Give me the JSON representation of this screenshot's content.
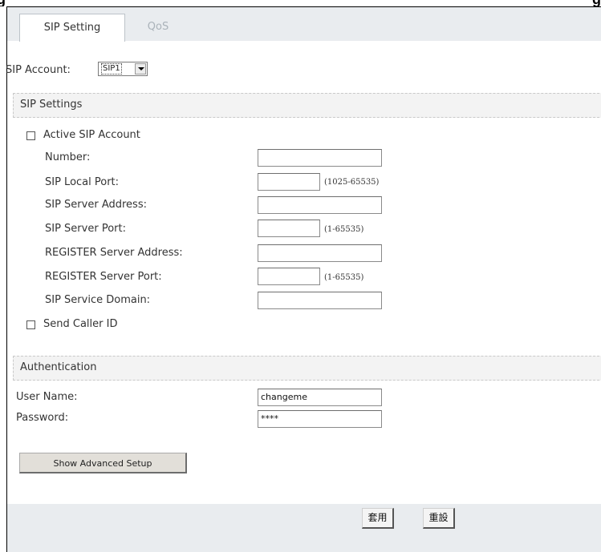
{
  "caption": {
    "left_fragment": "g",
    "right_fragment": "g"
  },
  "tabs": [
    {
      "label": "SIP Setting",
      "active": true
    },
    {
      "label": "QoS",
      "active": false
    }
  ],
  "sip_account": {
    "label": "SIP Account:",
    "selected": "SIP1"
  },
  "sip_settings": {
    "heading": "SIP Settings",
    "active_label": "Active SIP Account",
    "number_label": "Number:",
    "local_port_label": "SIP Local Port:",
    "local_port_hint": "(1025-65535)",
    "server_address_label": "SIP Server Address:",
    "server_port_label": "SIP Server Port:",
    "server_port_hint": "(1-65535)",
    "register_address_label": "REGISTER Server Address:",
    "register_port_label": "REGISTER Server Port:",
    "register_port_hint": "(1-65535)",
    "service_domain_label": "SIP Service Domain:",
    "send_caller_id_label": "Send Caller ID"
  },
  "authentication": {
    "heading": "Authentication",
    "user_label": "User Name:",
    "user_value": "changeme",
    "password_label": "Password:",
    "password_value": "****"
  },
  "buttons": {
    "advanced": "Show Advanced Setup",
    "apply": "套用",
    "reset": "重設"
  }
}
